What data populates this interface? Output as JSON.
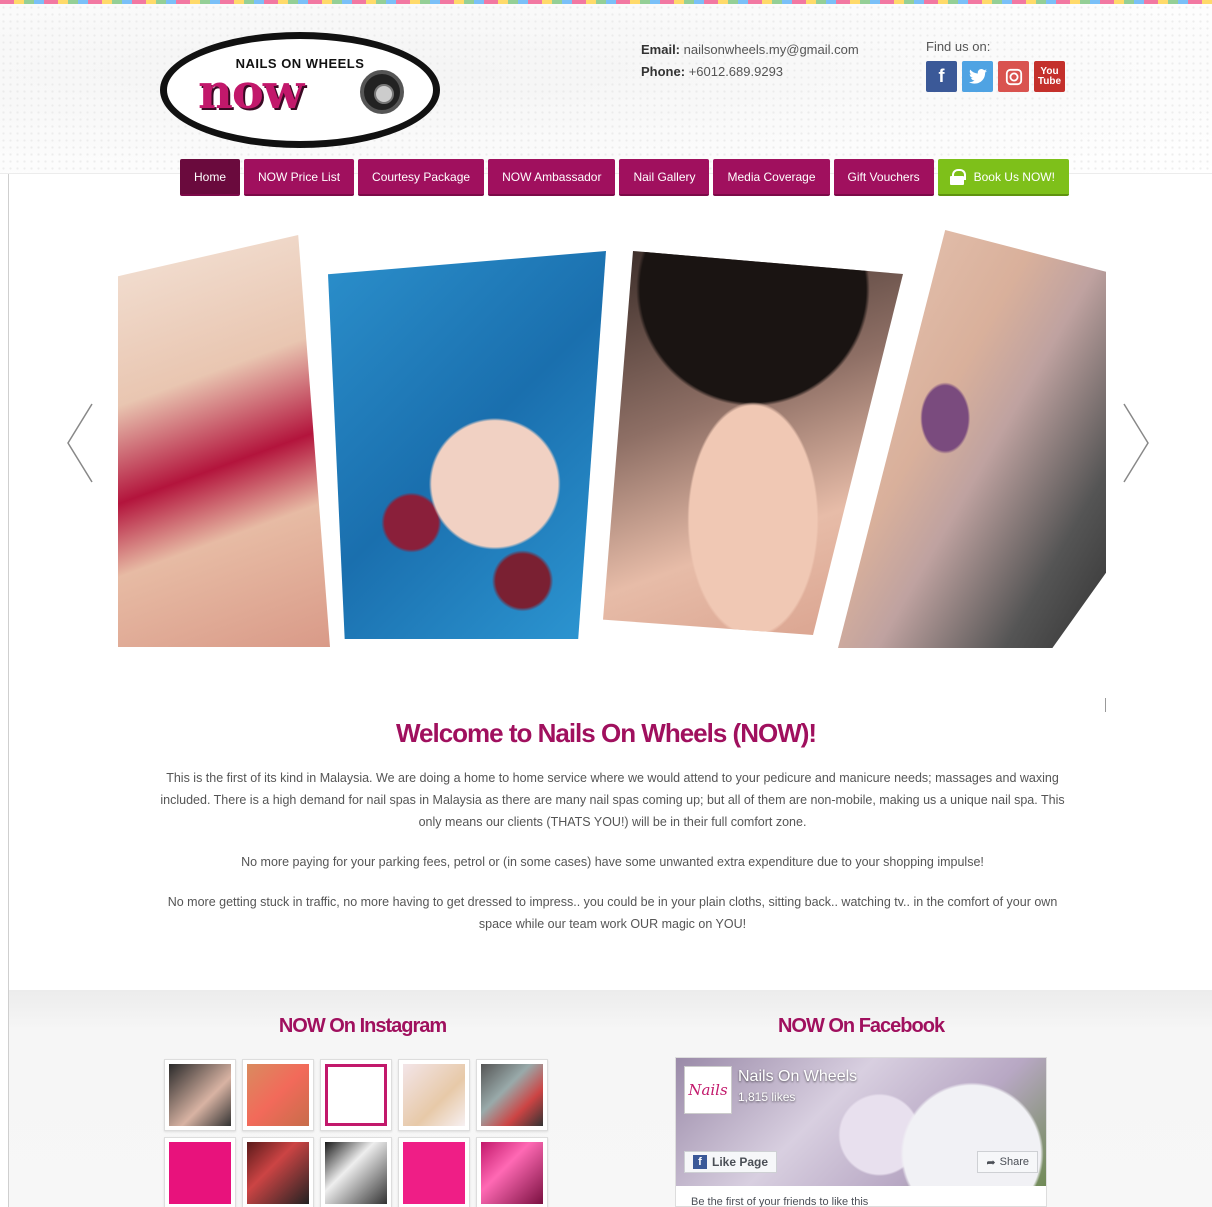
{
  "header": {
    "logo_top": "NAILS ON WHEELS",
    "logo_main": "now",
    "email_label": "Email:",
    "email_value": "nailsonwheels.my@gmail.com",
    "phone_label": "Phone:",
    "phone_value": "+6012.689.9293",
    "find_us": "Find us on:",
    "social": [
      "f",
      "t",
      "ig",
      "You Tube"
    ]
  },
  "nav": {
    "items": [
      "Home",
      "NOW Price List",
      "Courtesy Package",
      "NOW Ambassador",
      "Nail Gallery",
      "Media Coverage",
      "Gift Vouchers"
    ],
    "book": "Book Us NOW!"
  },
  "welcome": {
    "title": "Welcome to Nails On Wheels (NOW)!",
    "p1": "This is the first of its kind in Malaysia. We are doing a home to home service where we would attend to your pedicure and manicure needs; massages and waxing included. There is a high demand for nail spas in Malaysia as there are many nail spas coming up; but all of them are non-mobile, making us a unique nail spa. This only means our clients (THATS YOU!) will be in their full comfort zone.",
    "p2": "No more paying for your parking fees, petrol or (in some cases) have some unwanted extra expenditure due to your shopping impulse!",
    "p3": "No more getting stuck in traffic, no more having to get dressed to impress.. you could be in your plain cloths, sitting back.. watching tv.. in the comfort of your own space while our team work OUR magic on YOU!"
  },
  "instagram": {
    "title": "NOW On Instagram"
  },
  "facebook": {
    "title": "NOW On Facebook",
    "logo": "Nails",
    "page_name": "Nails On Wheels",
    "likes": "1,815 likes",
    "like_button": "Like Page",
    "share_button": "Share",
    "friends": "Be the first of your friends to like this"
  },
  "colors": {
    "brand": "#a0105e",
    "book": "#7ec01a"
  }
}
